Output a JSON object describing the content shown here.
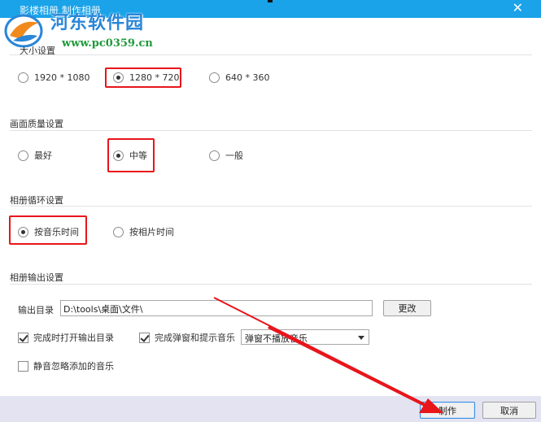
{
  "window": {
    "title": "影楼相册 制作相册",
    "close_glyph": "✕"
  },
  "watermark": {
    "site_name": "河东软件园",
    "url": "www.pc0359.cn"
  },
  "size_section": {
    "label": "大小设置",
    "options": [
      "1920 * 1080",
      "1280 * 720",
      "640 * 360"
    ],
    "selected": "1280 * 720"
  },
  "quality_section": {
    "label": "画面质量设置",
    "options": [
      "最好",
      "中等",
      "一般"
    ],
    "selected": "中等"
  },
  "loop_section": {
    "label": "相册循环设置",
    "options": [
      "按音乐时间",
      "按相片时间"
    ],
    "selected": "按音乐时间"
  },
  "output_section": {
    "label": "相册输出设置",
    "dir_label": "输出目录",
    "dir_value": "D:\\tools\\桌面\\文件\\",
    "change_button": "更改",
    "open_dir_checkbox": "完成时打开输出目录",
    "popup_checkbox": "完成弹窗和提示音乐",
    "music_select_value": "弹窗不播放音乐",
    "mute_checkbox": "静音忽略添加的音乐",
    "open_dir_checked": true,
    "popup_checked": true,
    "mute_checked": false
  },
  "footer": {
    "make_button": "制作",
    "cancel_button": "取消"
  },
  "colors": {
    "titlebar": "#1aa3e8",
    "highlight": "#e8151b",
    "footer": "#e3e3f2"
  }
}
